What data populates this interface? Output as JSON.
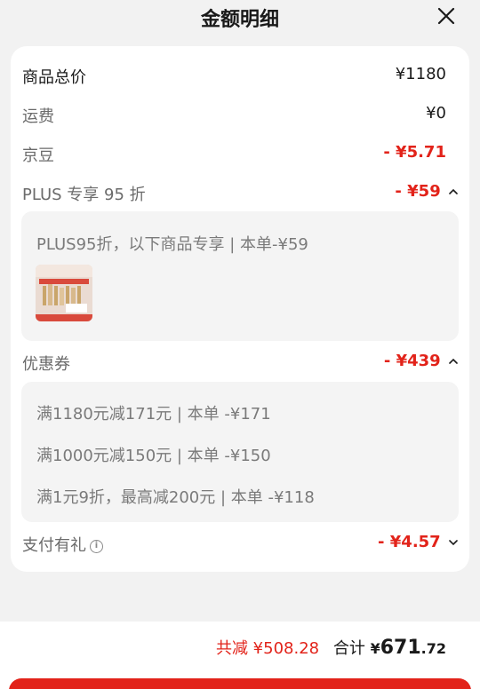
{
  "header": {
    "title": "金额明细"
  },
  "rows": {
    "total_price": {
      "label": "商品总价",
      "value": "¥1180"
    },
    "shipping": {
      "label": "运费",
      "value": "¥0"
    },
    "jingdou": {
      "label": "京豆",
      "value": "- ¥5.71"
    },
    "plus": {
      "label": "PLUS 专享 95 折",
      "value": "- ¥59",
      "detail": "PLUS95折，以下商品专享 | 本单-¥59"
    },
    "coupon": {
      "label": "优惠券",
      "value": "- ¥439",
      "details": [
        "满1180元减171元 | 本单 -¥171",
        "满1000元减150元 | 本单 -¥150",
        "满1元9折，最高减200元 | 本单 -¥118"
      ]
    },
    "payment_gift": {
      "label": "支付有礼",
      "value": "- ¥4.57"
    }
  },
  "footer": {
    "saved": "共减 ¥508.28",
    "total_label": "合计",
    "total_currency": "¥",
    "total_int": "671",
    "total_dec": ".72"
  },
  "colors": {
    "accent": "#e2231a",
    "background": "#f2f2f2"
  },
  "icons": {
    "close": "close-icon",
    "chevron_up": "chevron-up-icon",
    "chevron_down": "chevron-down-icon",
    "info": "info-icon"
  }
}
